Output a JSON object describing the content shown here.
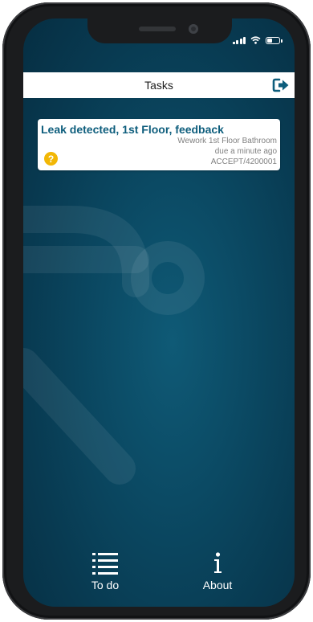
{
  "header": {
    "title": "Tasks",
    "logout_icon": "sign-out-icon"
  },
  "tasks": [
    {
      "title": "Leak detected, 1st Floor, feedback",
      "location": "Wework 1st Floor Bathroom",
      "due": "due a minute ago",
      "code": "ACCEPT/4200001",
      "status_icon": "question-mark-icon",
      "status_symbol": "?"
    }
  ],
  "tabs": [
    {
      "label": "To do",
      "icon": "list-icon"
    },
    {
      "label": "About",
      "icon": "info-icon"
    }
  ],
  "colors": {
    "background": "#0b4a64",
    "accent": "#0d5d7c",
    "badge": "#f2b705"
  }
}
